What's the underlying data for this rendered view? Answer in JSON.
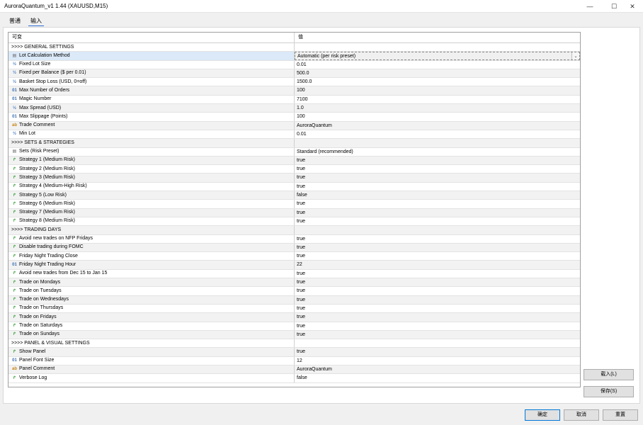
{
  "window": {
    "title": "AuroraQuantum_v1 1.44 (XAUUSD,M15)",
    "minimize_glyph": "—",
    "maximize_glyph": "☐",
    "close_glyph": "✕"
  },
  "tabs": [
    {
      "label": "普通"
    },
    {
      "label": "输入"
    }
  ],
  "table": {
    "headers": {
      "variable": "可变",
      "value": "值"
    },
    "rows": [
      {
        "icon": "",
        "name": ">>>> GENERAL SETTINGS",
        "value": ""
      },
      {
        "icon": "enum",
        "name": "Lot Calculation Method",
        "value": "Automatic (per risk preset)"
      },
      {
        "icon": "frac",
        "name": "Fixed Lot Size",
        "value": "0.01"
      },
      {
        "icon": "frac",
        "name": "Fixed per Balance ($ per 0.01)",
        "value": "500.0"
      },
      {
        "icon": "frac",
        "name": "Basket Stop Loss (USD, 0=off)",
        "value": "1500.0"
      },
      {
        "icon": "num",
        "name": "Max Number of Orders",
        "value": "100"
      },
      {
        "icon": "num",
        "name": "Magic Number",
        "value": "7100"
      },
      {
        "icon": "frac",
        "name": "Max Spread (USD)",
        "value": "1.0"
      },
      {
        "icon": "num",
        "name": "Max Slippage (Points)",
        "value": "100"
      },
      {
        "icon": "str",
        "name": "Trade Comment",
        "value": "AuroraQuantum"
      },
      {
        "icon": "frac",
        "name": "Min Lot",
        "value": "0.01"
      },
      {
        "icon": "",
        "name": ">>>> SETS & STRATEGIES",
        "value": ""
      },
      {
        "icon": "enum",
        "name": "Sets (Risk Preset)",
        "value": "Standard (recommended)"
      },
      {
        "icon": "bool",
        "name": "Strategy 1 (Medium Risk)",
        "value": "true"
      },
      {
        "icon": "bool",
        "name": "Strategy 2 (Medium Risk)",
        "value": "true"
      },
      {
        "icon": "bool",
        "name": "Strategy 3 (Medium Risk)",
        "value": "true"
      },
      {
        "icon": "bool",
        "name": "Strategy 4 (Medium-High Risk)",
        "value": "true"
      },
      {
        "icon": "bool",
        "name": "Strategy 5 (Low Risk)",
        "value": "false"
      },
      {
        "icon": "bool",
        "name": "Strategy 6 (Medium Risk)",
        "value": "true"
      },
      {
        "icon": "bool",
        "name": "Strategy 7 (Medium Risk)",
        "value": "true"
      },
      {
        "icon": "bool",
        "name": "Strategy 8 (Medium Risk)",
        "value": "true"
      },
      {
        "icon": "",
        "name": ">>>> TRADING DAYS",
        "value": ""
      },
      {
        "icon": "bool",
        "name": "Avoid new trades on NFP Fridays",
        "value": "true"
      },
      {
        "icon": "bool",
        "name": "Disable trading during FOMC",
        "value": "true"
      },
      {
        "icon": "bool",
        "name": "Friday Night Trading Close",
        "value": "true"
      },
      {
        "icon": "num",
        "name": "Friday Night Trading Hour",
        "value": "22"
      },
      {
        "icon": "bool",
        "name": "Avoid new trades from Dec 15 to Jan 15",
        "value": "true"
      },
      {
        "icon": "bool",
        "name": "Trade on Mondays",
        "value": "true"
      },
      {
        "icon": "bool",
        "name": "Trade on Tuesdays",
        "value": "true"
      },
      {
        "icon": "bool",
        "name": "Trade on Wednesdays",
        "value": "true"
      },
      {
        "icon": "bool",
        "name": "Trade on Thursdays",
        "value": "true"
      },
      {
        "icon": "bool",
        "name": "Trade on Fridays",
        "value": "true"
      },
      {
        "icon": "bool",
        "name": "Trade on Saturdays",
        "value": "true"
      },
      {
        "icon": "bool",
        "name": "Trade on Sundays",
        "value": "true"
      },
      {
        "icon": "",
        "name": ">>>> PANEL & VISUAL SETTINGS",
        "value": ""
      },
      {
        "icon": "bool",
        "name": "Show Panel",
        "value": "true"
      },
      {
        "icon": "num",
        "name": "Panel Font Size",
        "value": "12"
      },
      {
        "icon": "str",
        "name": "Panel Comment",
        "value": "AuroraQuantum"
      },
      {
        "icon": "bool",
        "name": "Verbose Log",
        "value": "false"
      }
    ]
  },
  "icon_glyphs": {
    "num": "01",
    "frac": "½",
    "bool": "↱",
    "str": "ab",
    "enum": "▤"
  },
  "buttons": {
    "load": "载入(L)",
    "save": "保存(S)",
    "ok": "确定",
    "cancel": "取消",
    "reset": "重置"
  }
}
